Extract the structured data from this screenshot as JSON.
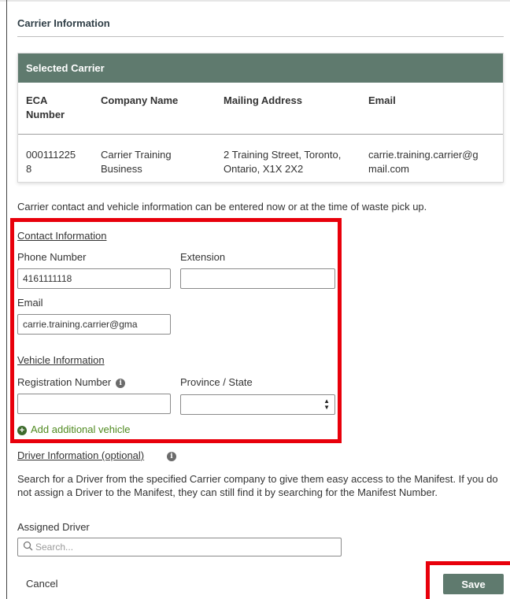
{
  "section": {
    "title": "Carrier Information"
  },
  "selected_carrier": {
    "header": "Selected Carrier",
    "columns": [
      "ECA Number",
      "Company Name",
      "Mailing Address",
      "Email"
    ],
    "eca_header_line1": "ECA",
    "eca_header_line2": "Number",
    "row": {
      "eca_line1": "000111225",
      "eca_line2": "8",
      "company_line1": "Carrier Training",
      "company_line2": "Business",
      "address_line1": "2 Training Street, Toronto,",
      "address_line2": "Ontario, X1X 2X2",
      "email_line1": "carrie.training.carrier@g",
      "email_line2": "mail.com"
    }
  },
  "intro_text": "Carrier contact and vehicle information can be entered now or at the time of waste pick up.",
  "contact": {
    "heading": "Contact Information",
    "phone_label": "Phone Number",
    "phone_value": "4161111118",
    "extension_label": "Extension",
    "extension_value": "",
    "email_label": "Email",
    "email_value": "carrie.training.carrier@gma"
  },
  "vehicle": {
    "heading": "Vehicle Information",
    "registration_label": "Registration Number",
    "registration_value": "",
    "province_label": "Province / State",
    "province_value": "",
    "add_label": "Add additional vehicle"
  },
  "driver": {
    "heading": "Driver Information (optional)",
    "description": "Search for a Driver from the specified Carrier company to give them easy access to the Manifest. If you do not assign a Driver to the Manifest, they can still find it by searching for the Manifest Number.",
    "assigned_label": "Assigned Driver",
    "search_placeholder": "Search..."
  },
  "actions": {
    "cancel_label": "Cancel",
    "save_label": "Save"
  },
  "colors": {
    "accent": "#5f7a6e",
    "link_green": "#4f8a1f",
    "highlight_red": "#e8000b"
  }
}
